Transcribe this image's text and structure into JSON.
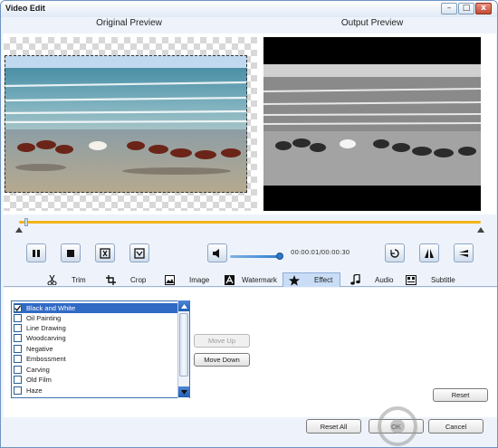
{
  "window": {
    "title": "Video Edit",
    "controls": {
      "minimize": "–",
      "maximize": "□",
      "close": "x"
    }
  },
  "preview": {
    "original_label": "Original Preview",
    "output_label": "Output Preview"
  },
  "timeline": {
    "progress": 0.03
  },
  "playback": {
    "time_display": "00:00:01/00:00:30",
    "volume_level": 0.85
  },
  "tabs": [
    {
      "id": "trim",
      "label": "Trim",
      "icon": "scissors-icon"
    },
    {
      "id": "crop",
      "label": "Crop",
      "icon": "crop-icon"
    },
    {
      "id": "image",
      "label": "Image",
      "icon": "image-icon"
    },
    {
      "id": "watermark",
      "label": "Watermark",
      "icon": "watermark-icon"
    },
    {
      "id": "effect",
      "label": "Effect",
      "icon": "star-icon",
      "active": true
    },
    {
      "id": "audio",
      "label": "Audio",
      "icon": "music-note-icon"
    },
    {
      "id": "subtitle",
      "label": "Subtitle",
      "icon": "subtitle-icon"
    }
  ],
  "effects": {
    "items": [
      {
        "label": "Black and White",
        "checked": true,
        "selected": true
      },
      {
        "label": "Oil Painting",
        "checked": false
      },
      {
        "label": "Line Drawing",
        "checked": false
      },
      {
        "label": "Woodcarving",
        "checked": false
      },
      {
        "label": "Negative",
        "checked": false
      },
      {
        "label": "Embossment",
        "checked": false
      },
      {
        "label": "Carving",
        "checked": false
      },
      {
        "label": "Old Film",
        "checked": false
      },
      {
        "label": "Haze",
        "checked": false
      }
    ],
    "move_up_label": "Move Up",
    "move_down_label": "Move Down",
    "reset_label": "Reset"
  },
  "footer": {
    "reset_all_label": "Reset All",
    "ok_label": "OK",
    "cancel_label": "Cancel"
  },
  "colors": {
    "timeline_accent": "#f2b41b",
    "selection": "#316ac5",
    "frame": "#6f93c4"
  }
}
